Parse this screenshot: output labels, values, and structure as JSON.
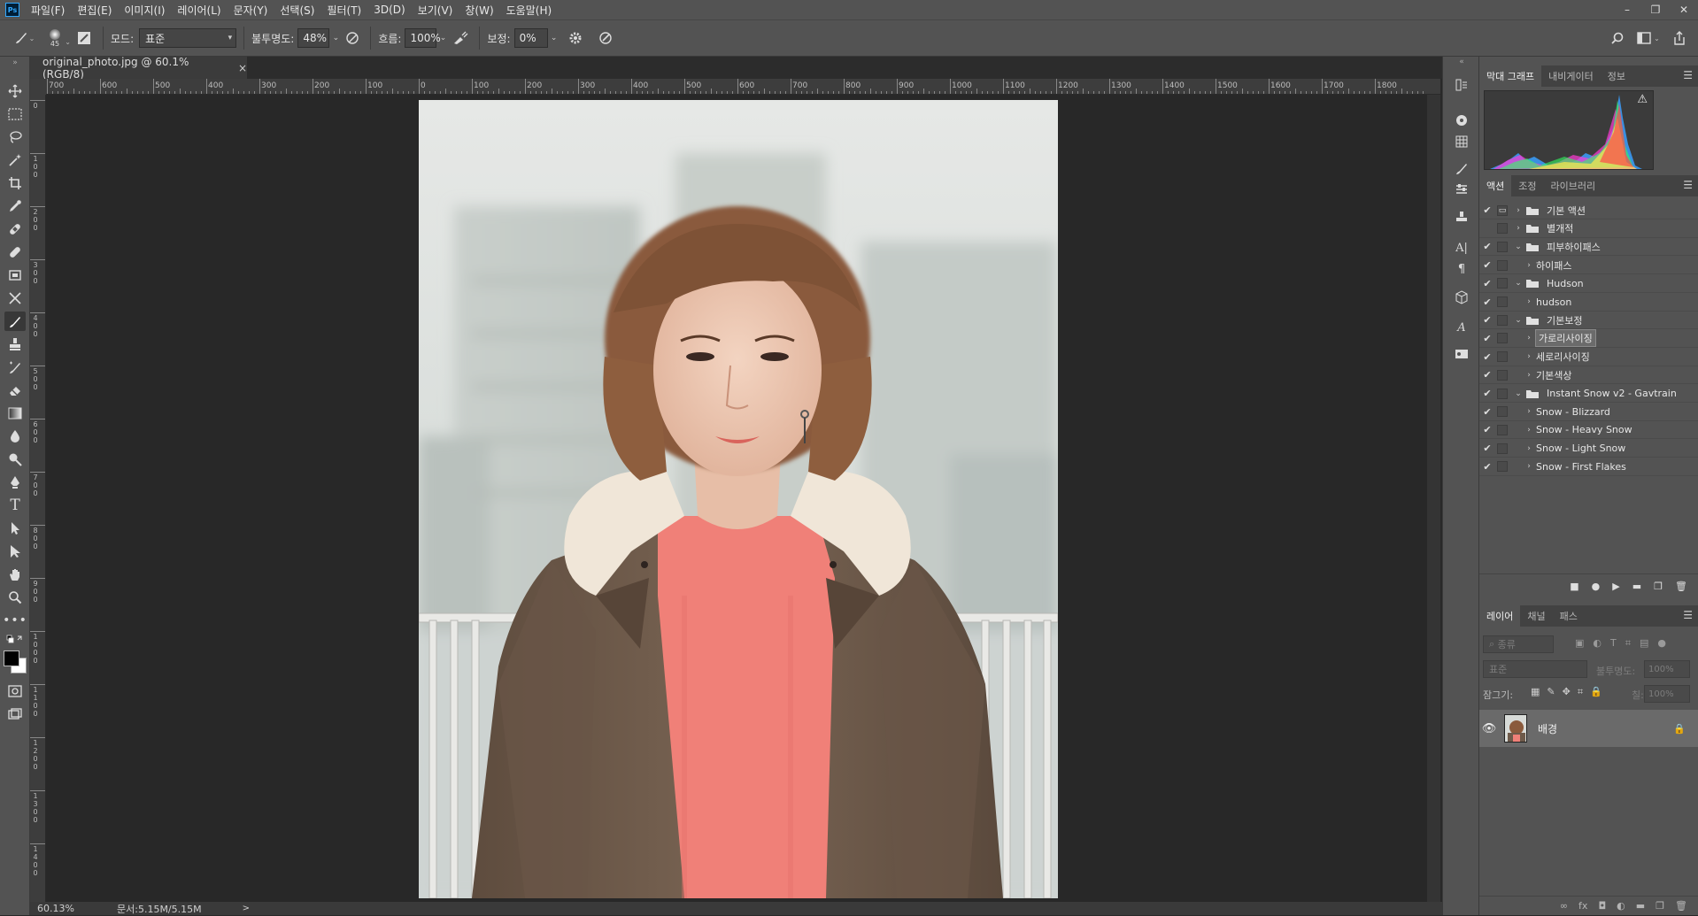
{
  "menubar": {
    "app_icon": "Ps",
    "items": [
      "파일(F)",
      "편집(E)",
      "이미지(I)",
      "레이어(L)",
      "문자(Y)",
      "선택(S)",
      "필터(T)",
      "3D(D)",
      "보기(V)",
      "창(W)",
      "도움말(H)"
    ],
    "window_controls": [
      "–",
      "❐",
      "✕"
    ]
  },
  "options_bar": {
    "brush_size": "45",
    "mode_label": "모드:",
    "mode_value": "표준",
    "opacity_label": "불투명도:",
    "opacity_value": "48%",
    "flow_label": "흐름:",
    "flow_value": "100%",
    "smoothing_label": "보정:",
    "smoothing_value": "0%"
  },
  "document": {
    "tab_title": "original_photo.jpg @ 60.1% (RGB/8)",
    "tab_close": "×",
    "zoom": "60.13%",
    "doc_size": "문서:5.15M/5.15M",
    "status_arrow": ">"
  },
  "ruler_top_labels": [
    "700",
    "600",
    "500",
    "400",
    "300",
    "200",
    "100",
    "0",
    "100",
    "200",
    "300",
    "400",
    "500",
    "600",
    "700",
    "800",
    "900",
    "1000",
    "1100",
    "1200",
    "1300",
    "1400",
    "1500",
    "1600",
    "1700",
    "1800"
  ],
  "ruler_left_labels": [
    "0",
    "100",
    "200",
    "300",
    "400",
    "500",
    "600",
    "700",
    "800",
    "900",
    "1000",
    "1100",
    "1200",
    "1300",
    "1400"
  ],
  "histogram_panel": {
    "tabs": [
      "막대 그래프",
      "내비게이터",
      "정보"
    ],
    "warning_icon": "⚠"
  },
  "actions_panel": {
    "tabs": [
      "액션",
      "조정",
      "라이브러리"
    ],
    "rows": [
      {
        "label": "기본 액션",
        "type": "set",
        "expanded": false,
        "checked": true,
        "dialog": true,
        "indent": 0
      },
      {
        "label": "별개적",
        "type": "set",
        "expanded": false,
        "checked": false,
        "dialog": false,
        "indent": 0
      },
      {
        "label": "피부하이패스",
        "type": "set",
        "expanded": true,
        "checked": true,
        "dialog": false,
        "indent": 0
      },
      {
        "label": "하이패스",
        "type": "action",
        "expanded": false,
        "checked": true,
        "dialog": false,
        "indent": 1
      },
      {
        "label": "Hudson",
        "type": "set",
        "expanded": true,
        "checked": true,
        "dialog": false,
        "indent": 0
      },
      {
        "label": "hudson",
        "type": "action",
        "expanded": false,
        "checked": true,
        "dialog": false,
        "indent": 1
      },
      {
        "label": "기본보정",
        "type": "set",
        "expanded": true,
        "checked": true,
        "dialog": false,
        "indent": 0
      },
      {
        "label": "가로리사이징",
        "type": "action",
        "expanded": false,
        "checked": true,
        "dialog": false,
        "indent": 1,
        "selected": true
      },
      {
        "label": "세로리사이징",
        "type": "action",
        "expanded": false,
        "checked": true,
        "dialog": false,
        "indent": 1
      },
      {
        "label": "기본색상",
        "type": "action",
        "expanded": false,
        "checked": true,
        "dialog": false,
        "indent": 1
      },
      {
        "label": "Instant Snow v2 - Gavtrain",
        "type": "set",
        "expanded": true,
        "checked": true,
        "dialog": false,
        "indent": 0
      },
      {
        "label": "Snow - Blizzard",
        "type": "action",
        "expanded": false,
        "checked": true,
        "dialog": false,
        "indent": 1
      },
      {
        "label": "Snow - Heavy Snow",
        "type": "action",
        "expanded": false,
        "checked": true,
        "dialog": false,
        "indent": 1
      },
      {
        "label": "Snow - Light Snow",
        "type": "action",
        "expanded": false,
        "checked": true,
        "dialog": false,
        "indent": 1
      },
      {
        "label": "Snow - First Flakes",
        "type": "action",
        "expanded": false,
        "checked": true,
        "dialog": false,
        "indent": 1
      }
    ],
    "footer_icons": [
      "stop-icon",
      "record-icon",
      "play-icon",
      "new-set-icon",
      "new-action-icon",
      "delete-icon"
    ]
  },
  "layers_panel": {
    "tabs": [
      "레이어",
      "채널",
      "패스"
    ],
    "filter_placeholder": "종류",
    "blend_mode": "표준",
    "opacity_label": "불투명도:",
    "opacity_value": "100%",
    "lock_label": "잠그기:",
    "fill_label": "칠:",
    "fill_value": "100%",
    "layers": [
      {
        "name": "배경",
        "visible": true,
        "locked": true
      }
    ]
  },
  "colors": {
    "ui_bg": "#535353",
    "canvas_bg": "#282828",
    "sweater": "#f08078",
    "coat": "#6e5a4a"
  }
}
